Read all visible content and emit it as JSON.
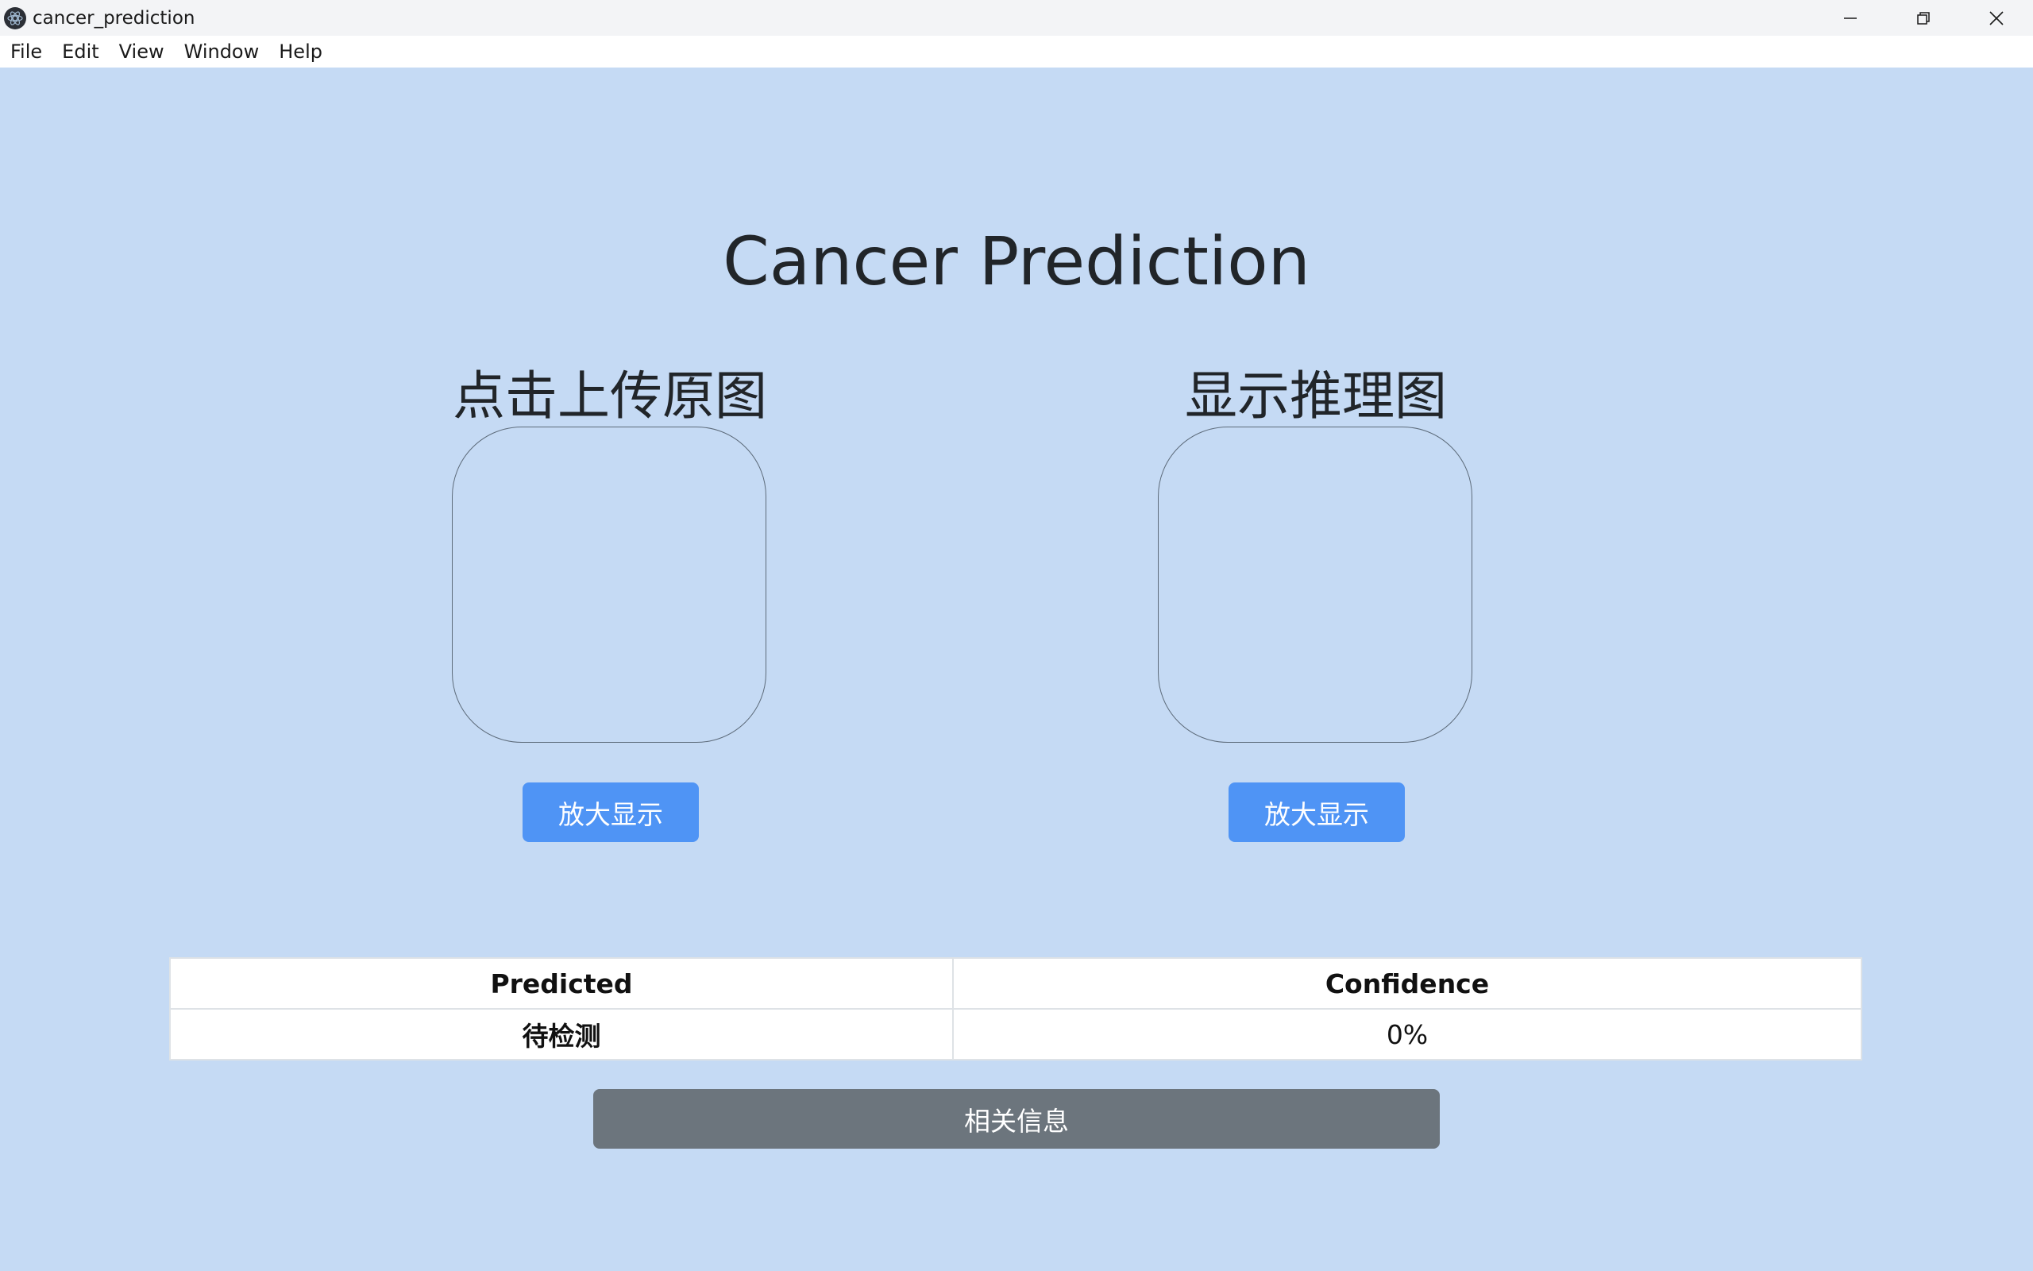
{
  "window": {
    "title": "cancer_prediction"
  },
  "menu": {
    "items": [
      "File",
      "Edit",
      "View",
      "Window",
      "Help"
    ]
  },
  "main": {
    "title": "Cancer Prediction",
    "left_panel": {
      "title": "点击上传原图",
      "button_label": "放大显示"
    },
    "right_panel": {
      "title": "显示推理图",
      "button_label": "放大显示"
    },
    "table": {
      "headers": [
        "Predicted",
        "Confidence"
      ],
      "rows": [
        [
          "待检测",
          "0%"
        ]
      ]
    },
    "info_button_label": "相关信息"
  },
  "colors": {
    "background": "#c5daf4",
    "primary_button": "#4f94f5",
    "secondary_button": "#6c757d"
  }
}
